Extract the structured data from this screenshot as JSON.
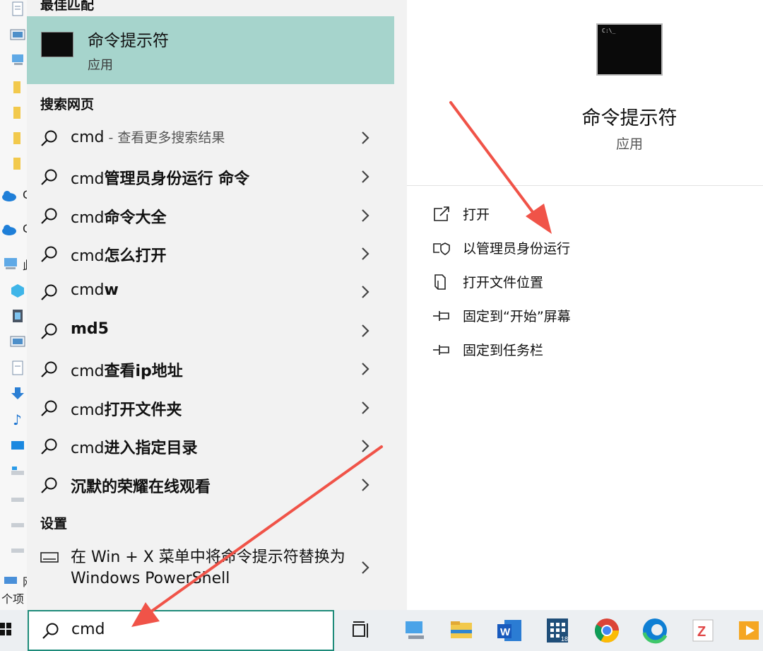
{
  "left_strip": {
    "frag1": "C",
    "frag2": "C",
    "frag3": "此",
    "frag4": "网",
    "frag5": "个项"
  },
  "best_match": {
    "header": "最佳匹配",
    "title": "命令提示符",
    "subtitle": "应用"
  },
  "web": {
    "header": "搜索网页",
    "items": [
      {
        "prefix": "cmd",
        "suffix": "",
        "hint": " - 查看更多搜索结果"
      },
      {
        "prefix": "cmd",
        "suffix": "管理员身份运行 命令",
        "hint": ""
      },
      {
        "prefix": "cmd",
        "suffix": "命令大全",
        "hint": ""
      },
      {
        "prefix": "cmd",
        "suffix": "怎么打开",
        "hint": ""
      },
      {
        "prefix": "cmd",
        "suffix": "w",
        "hint": ""
      },
      {
        "prefix": "",
        "suffix": "md5",
        "hint": ""
      },
      {
        "prefix": "cmd",
        "suffix": "查看ip地址",
        "hint": ""
      },
      {
        "prefix": "cmd",
        "suffix": "打开文件夹",
        "hint": ""
      },
      {
        "prefix": "cmd",
        "suffix": "进入指定目录",
        "hint": ""
      },
      {
        "prefix": "",
        "suffix": "沉默的荣耀在线观看",
        "hint": ""
      }
    ]
  },
  "settings": {
    "header": "设置",
    "item": "在 Win + X 菜单中将命令提示符替换为 Windows PowerShell"
  },
  "detail": {
    "title": "命令提示符",
    "subtitle": "应用",
    "prompt": "C:\\_",
    "actions": [
      {
        "label": "打开",
        "icon": "open-icon"
      },
      {
        "label": "以管理员身份运行",
        "icon": "shield-icon"
      },
      {
        "label": "打开文件位置",
        "icon": "file-location-icon"
      },
      {
        "label": "固定到“开始”屏幕",
        "icon": "pin-icon"
      },
      {
        "label": "固定到任务栏",
        "icon": "pin-icon"
      }
    ]
  },
  "search": {
    "value": "cmd"
  },
  "taskbar": {
    "apps": [
      "task-view-icon",
      "this-pc-icon",
      "file-explorer-icon",
      "word-icon",
      "calculator-icon",
      "chrome-icon",
      "edge-icon",
      "app-z-icon",
      "media-player-icon"
    ],
    "calculator_badge": "18",
    "word_letter": "W",
    "z_letter": "Z"
  },
  "colors": {
    "best_match_bg": "#a6d4cc",
    "search_border": "#1e8b7a",
    "arrow": "#f05348"
  }
}
